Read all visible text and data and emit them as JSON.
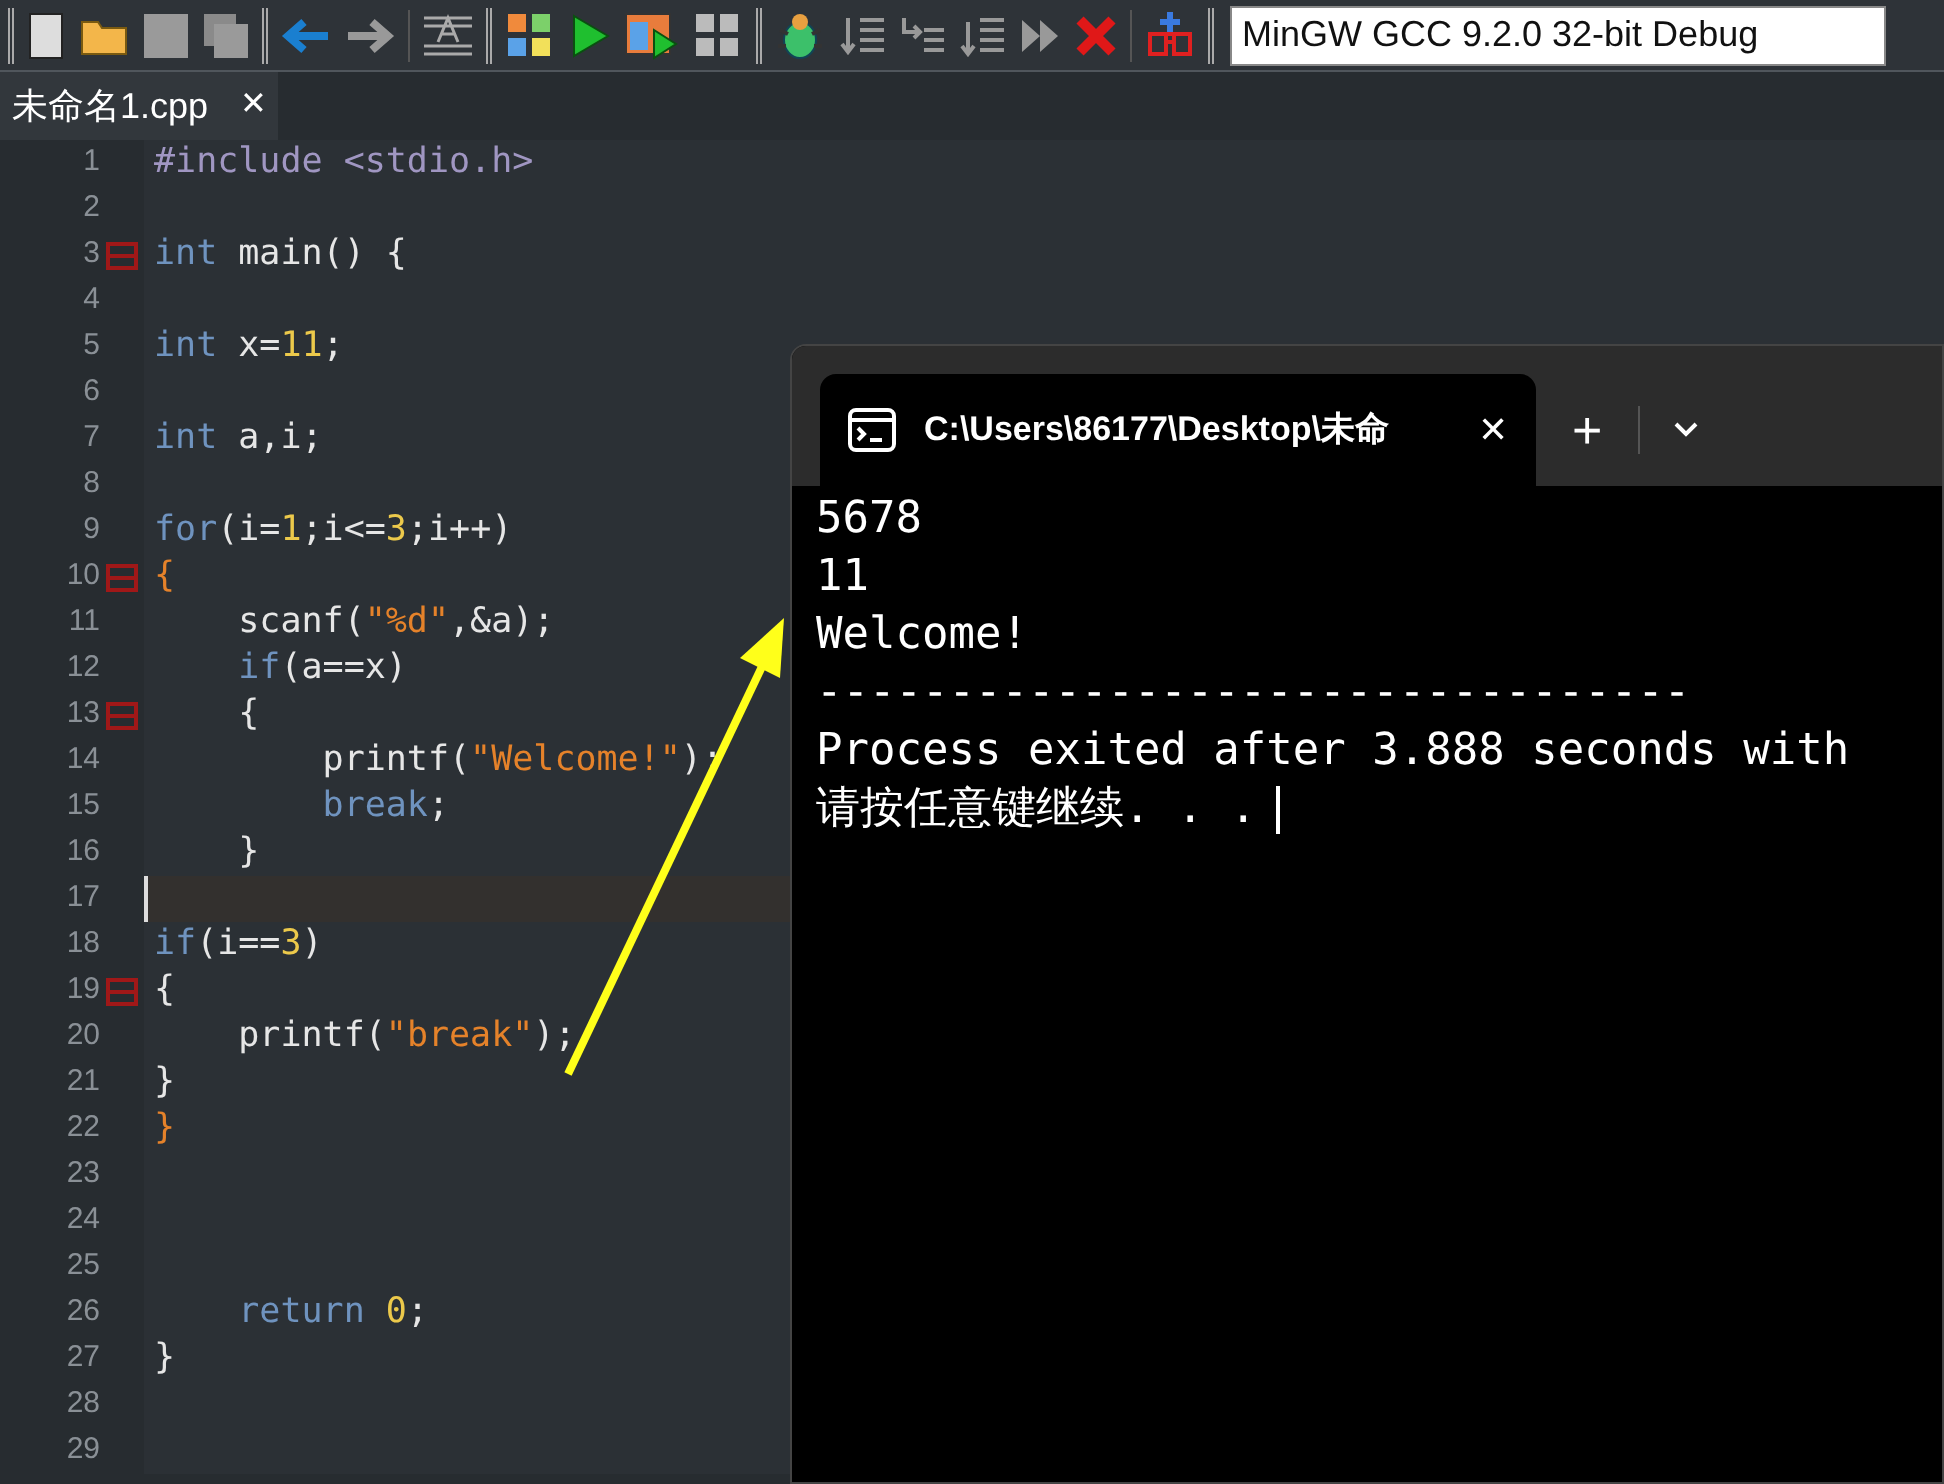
{
  "compiler_select": {
    "value": "MinGW GCC 9.2.0 32-bit Debug"
  },
  "file_tab": {
    "label": "未命名1.cpp",
    "close": "✕",
    "selected": true
  },
  "code_lines": [
    {
      "number": "1",
      "fold": false,
      "current": false,
      "tokens": [
        {
          "kind": "preproc",
          "text": "#include <stdio.h>"
        }
      ]
    },
    {
      "number": "2",
      "fold": false,
      "current": false
    },
    {
      "number": "3",
      "fold": true,
      "current": false,
      "tokens": [
        {
          "kind": "keyword",
          "text": "int"
        },
        {
          "kind": "plain",
          "text": " main() {"
        }
      ]
    },
    {
      "number": "4",
      "fold": false,
      "current": false
    },
    {
      "number": "5",
      "fold": false,
      "current": false,
      "tokens": [
        {
          "kind": "keyword",
          "text": "int"
        },
        {
          "kind": "plain",
          "text": " x="
        },
        {
          "kind": "number",
          "text": "11"
        },
        {
          "kind": "plain",
          "text": ";"
        }
      ]
    },
    {
      "number": "6",
      "fold": false,
      "current": false
    },
    {
      "number": "7",
      "fold": false,
      "current": false,
      "tokens": [
        {
          "kind": "keyword",
          "text": "int"
        },
        {
          "kind": "plain",
          "text": " a,i;"
        }
      ]
    },
    {
      "number": "8",
      "fold": false,
      "current": false
    },
    {
      "number": "9",
      "fold": false,
      "current": false,
      "tokens": [
        {
          "kind": "keyword",
          "text": "for"
        },
        {
          "kind": "plain",
          "text": "(i="
        },
        {
          "kind": "number",
          "text": "1"
        },
        {
          "kind": "plain",
          "text": ";i<="
        },
        {
          "kind": "number",
          "text": "3"
        },
        {
          "kind": "plain",
          "text": ";i++)"
        }
      ]
    },
    {
      "number": "10",
      "fold": true,
      "current": false,
      "tokens": [
        {
          "kind": "brace_match",
          "text": "{"
        }
      ]
    },
    {
      "number": "11",
      "fold": false,
      "current": false,
      "tokens": [
        {
          "kind": "plain",
          "text": "    scanf("
        },
        {
          "kind": "string",
          "text": "\"%d\""
        },
        {
          "kind": "plain",
          "text": ",&a);"
        }
      ]
    },
    {
      "number": "12",
      "fold": false,
      "current": false,
      "tokens": [
        {
          "kind": "keyword",
          "text": "    if"
        },
        {
          "kind": "plain",
          "text": "(a==x)"
        }
      ]
    },
    {
      "number": "13",
      "fold": true,
      "current": false,
      "tokens": [
        {
          "kind": "plain",
          "text": "    {"
        }
      ]
    },
    {
      "number": "14",
      "fold": false,
      "current": false,
      "tokens": [
        {
          "kind": "plain",
          "text": "        printf("
        },
        {
          "kind": "string",
          "text": "\"Welcome!\""
        },
        {
          "kind": "plain",
          "text": ");"
        }
      ]
    },
    {
      "number": "15",
      "fold": false,
      "current": false,
      "tokens": [
        {
          "kind": "keyword",
          "text": "        break"
        },
        {
          "kind": "plain",
          "text": ";"
        }
      ]
    },
    {
      "number": "16",
      "fold": false,
      "current": false,
      "tokens": [
        {
          "kind": "plain",
          "text": "    }"
        }
      ]
    },
    {
      "number": "17",
      "fold": false,
      "current": true
    },
    {
      "number": "18",
      "fold": false,
      "current": false,
      "tokens": [
        {
          "kind": "keyword",
          "text": "if"
        },
        {
          "kind": "plain",
          "text": "(i=="
        },
        {
          "kind": "number",
          "text": "3"
        },
        {
          "kind": "plain",
          "text": ")"
        }
      ]
    },
    {
      "number": "19",
      "fold": true,
      "current": false,
      "tokens": [
        {
          "kind": "plain",
          "text": "{"
        }
      ]
    },
    {
      "number": "20",
      "fold": false,
      "current": false,
      "tokens": [
        {
          "kind": "plain",
          "text": "    printf("
        },
        {
          "kind": "string",
          "text": "\"break\""
        },
        {
          "kind": "plain",
          "text": ");"
        }
      ]
    },
    {
      "number": "21",
      "fold": false,
      "current": false,
      "tokens": [
        {
          "kind": "plain",
          "text": "}"
        }
      ]
    },
    {
      "number": "22",
      "fold": false,
      "current": false,
      "tokens": [
        {
          "kind": "brace_match",
          "text": "}"
        }
      ]
    },
    {
      "number": "23",
      "fold": false,
      "current": false
    },
    {
      "number": "24",
      "fold": false,
      "current": false
    },
    {
      "number": "25",
      "fold": false,
      "current": false
    },
    {
      "number": "26",
      "fold": false,
      "current": false,
      "tokens": [
        {
          "kind": "keyword",
          "text": "    return"
        },
        {
          "kind": "number",
          "text": " 0"
        },
        {
          "kind": "plain",
          "text": ";"
        }
      ]
    },
    {
      "number": "27",
      "fold": false,
      "current": false,
      "tokens": [
        {
          "kind": "plain",
          "text": "}"
        }
      ]
    },
    {
      "number": "28",
      "fold": false,
      "current": false
    },
    {
      "number": "29",
      "fold": false,
      "current": false
    }
  ],
  "terminal": {
    "tab_title": "C:\\Users\\86177\\Desktop\\未命",
    "close": "✕",
    "new_tab": "+",
    "output": [
      "5678",
      "11",
      "Welcome!",
      "---------------------------------",
      "Process exited after 3.888 seconds with",
      "请按任意键继续. . ."
    ]
  }
}
